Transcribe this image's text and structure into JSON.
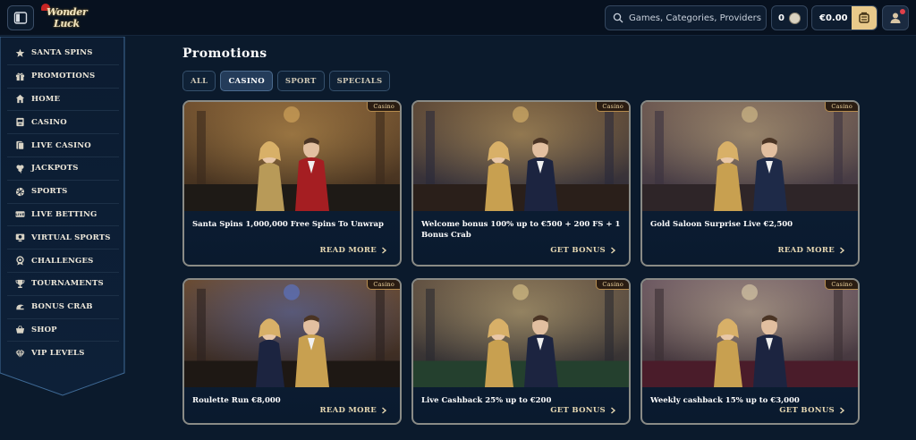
{
  "header": {
    "logo_line1": "Wonder",
    "logo_line2": "Luck",
    "search_placeholder": "Games, Categories, Providers",
    "points_value": "0",
    "balance": "€0.00"
  },
  "sidebar": {
    "items": [
      {
        "label": "Santa Spins",
        "icon": "star-icon"
      },
      {
        "label": "Promotions",
        "icon": "gift-icon"
      },
      {
        "label": "Home",
        "icon": "home-icon"
      },
      {
        "label": "Casino",
        "icon": "slot-icon"
      },
      {
        "label": "Live Casino",
        "icon": "live-casino-icon"
      },
      {
        "label": "Jackpots",
        "icon": "clover-icon"
      },
      {
        "label": "Sports",
        "icon": "ball-icon"
      },
      {
        "label": "Live Betting",
        "icon": "live-icon"
      },
      {
        "label": "Virtual Sports",
        "icon": "virtual-icon"
      },
      {
        "label": "Challenges",
        "icon": "medal-icon"
      },
      {
        "label": "Tournaments",
        "icon": "trophy-icon"
      },
      {
        "label": "Bonus Crab",
        "icon": "crab-icon"
      },
      {
        "label": "Shop",
        "icon": "basket-icon"
      },
      {
        "label": "VIP Levels",
        "icon": "diamond-icon"
      }
    ]
  },
  "main": {
    "title": "Promotions",
    "tabs": [
      {
        "label": "All",
        "active": false
      },
      {
        "label": "Casino",
        "active": true
      },
      {
        "label": "Sport",
        "active": false
      },
      {
        "label": "Specials",
        "active": false
      }
    ],
    "cards": [
      {
        "badge": "Casino",
        "title": "Santa Spins 1,000,000 Free Spins To Unwrap",
        "cta": "Read More"
      },
      {
        "badge": "Casino",
        "title": "Welcome bonus 100% up to €500 + 200 FS + 1 Bonus Crab",
        "cta": "Get Bonus"
      },
      {
        "badge": "Casino",
        "title": "Gold Saloon Surprise Live €2,500",
        "cta": "Read More"
      },
      {
        "badge": "Casino",
        "title": "Roulette Run €8,000",
        "cta": "Read More"
      },
      {
        "badge": "Casino",
        "title": "Live Cashback 25% up to €200",
        "cta": "Get Bonus"
      },
      {
        "badge": "Casino",
        "title": "Weekly cashback 15% up to €3,000",
        "cta": "Get Bonus"
      }
    ]
  },
  "colors": {
    "background": "#0b1a2c",
    "header": "#07111f",
    "gold_accent": "#e8c98a",
    "card_border": "#8a8b86"
  }
}
